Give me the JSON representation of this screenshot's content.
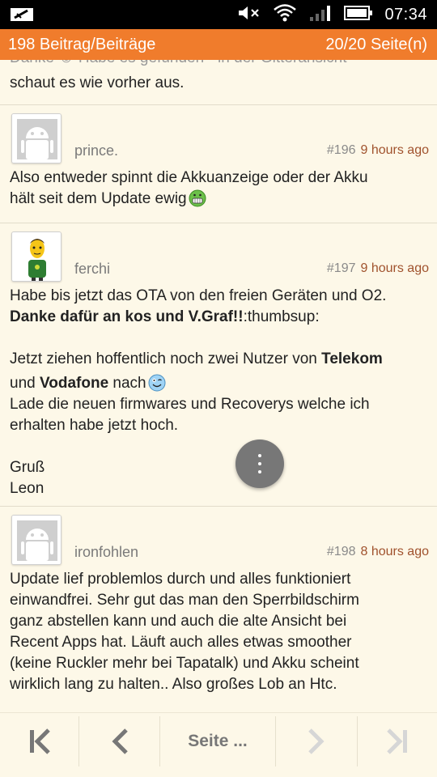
{
  "status": {
    "time": "07:34"
  },
  "header": {
    "post_count": "198 Beitrag/Beiträge",
    "pages": "20/20 Seite(n)"
  },
  "partial": {
    "cut_line": "Danke ☺ Habe es gefunden - in der Gitteransicht",
    "visible_line": "schaut es wie vorher aus."
  },
  "posts": [
    {
      "username": "prince.",
      "number": "#196",
      "ago": "9 hours ago",
      "body": [
        "Also entweder spinnt die Akkuanzeige oder der Akku",
        "hält seit dem Update ewig"
      ]
    },
    {
      "username": "ferchi",
      "number": "#197",
      "ago": "9 hours ago",
      "body": {
        "l1": "Habe bis jetzt das OTA von den freien Geräten und O2.",
        "l2_bold": "Danke dafür an kos und V.Graf!!",
        "l2_rest": ":thumbsup:",
        "l3_a": "Jetzt ziehen hoffentlich noch zwei Nutzer von ",
        "l3_bold": "Telekom",
        "l4_a": "und ",
        "l4_bold": "Vodafone",
        "l4_rest": " nach",
        "l5": "Lade die neuen firmwares und Recoverys welche ich",
        "l6": "erhalten habe jetzt hoch.",
        "l7": "Gruß",
        "l8": "Leon"
      }
    },
    {
      "username": "ironfohlen",
      "number": "#198",
      "ago": "8 hours ago",
      "body": [
        "Update lief problemlos durch und alles funktioniert",
        "einwandfrei. Sehr gut das man den Sperrbildschirm",
        "ganz abstellen kann und auch die alte Ansicht bei",
        "Recent Apps hat. Läuft auch alles etwas smoother",
        "(keine Ruckler mehr bei Tapatalk) und Akku scheint",
        "wirklich lang zu halten.. Also großes Lob an Htc."
      ]
    }
  ],
  "nav": {
    "page_label": "Seite ..."
  },
  "colors": {
    "accent": "#f07c2c",
    "background": "#fdf8e8",
    "time_ago": "#a0522d"
  }
}
